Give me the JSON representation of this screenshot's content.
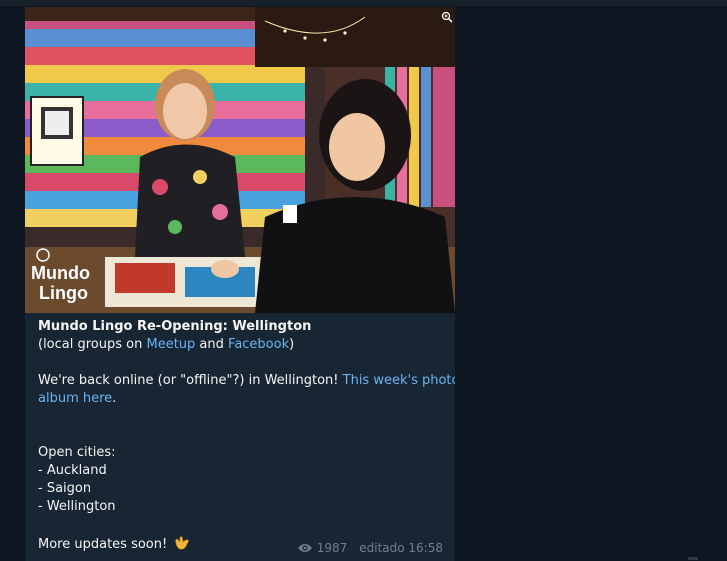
{
  "post": {
    "photo_logo": "Mundo Lingo",
    "title": "Mundo Lingo Re-Opening: Wellington",
    "groups_prefix": "(local groups on ",
    "groups_link1": "Meetup",
    "groups_and": " and ",
    "groups_link2": "Facebook",
    "groups_suffix": ")",
    "back_online": "We're back online (or \"offline\"?) in Wellington! ",
    "album_link_1": "This week's photo",
    "album_link_2": "album here",
    "album_period": ".",
    "open_cities_heading": "Open cities:",
    "cities": [
      "- Auckland",
      "- Saigon",
      "- Wellington"
    ],
    "closing": "More updates soon! ",
    "views": "1987",
    "edited_time": "editado 16:58",
    "icons": {
      "views": "eye-icon",
      "photo": "zoom-icon",
      "emoji": "call-me-hand-emoji"
    }
  },
  "colors": {
    "background": "#0e1621",
    "bubble": "#182533",
    "text": "#f5f5f5",
    "link": "#6ab3f3",
    "meta": "#6d7f8f"
  }
}
